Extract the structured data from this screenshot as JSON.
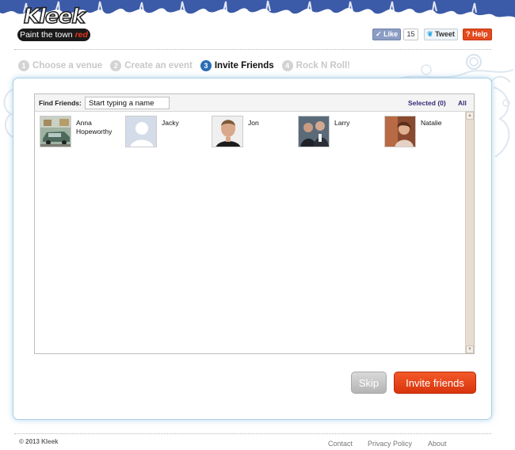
{
  "brand": {
    "logo_text": "Kleek",
    "tagline_main": "Paint the town ",
    "tagline_accent": "red",
    "colors": {
      "crowd_blue": "#3b5aa7",
      "accent_red": "#e2351c",
      "step_active": "#2a6db6"
    }
  },
  "social": {
    "like_label": "Like",
    "like_count": "15",
    "tweet_label": "Tweet",
    "help_label": "Help"
  },
  "steps": [
    {
      "num": "1",
      "label": "Choose a venue"
    },
    {
      "num": "2",
      "label": "Create an event"
    },
    {
      "num": "3",
      "label": "Invite Friends"
    },
    {
      "num": "4",
      "label": "Rock N Roll!"
    }
  ],
  "finder": {
    "label": "Find Friends:",
    "placeholder": "Start typing a name",
    "selected": "Selected (0)",
    "all": "All"
  },
  "friends": [
    {
      "name": "Anna Hopeworthy",
      "photo": "car-photo"
    },
    {
      "name": "Jacky",
      "photo": "default-silhouette"
    },
    {
      "name": "Jon",
      "photo": "portrait-photo"
    },
    {
      "name": "Larry",
      "photo": "two-men-photo"
    },
    {
      "name": "Natalie",
      "photo": "woman-photo"
    }
  ],
  "actions": {
    "skip": "Skip",
    "invite": "Invite friends"
  },
  "footer": {
    "copyright": "© 2013 Kleek",
    "links": [
      "Contact",
      "Privacy Policy",
      "About"
    ]
  }
}
